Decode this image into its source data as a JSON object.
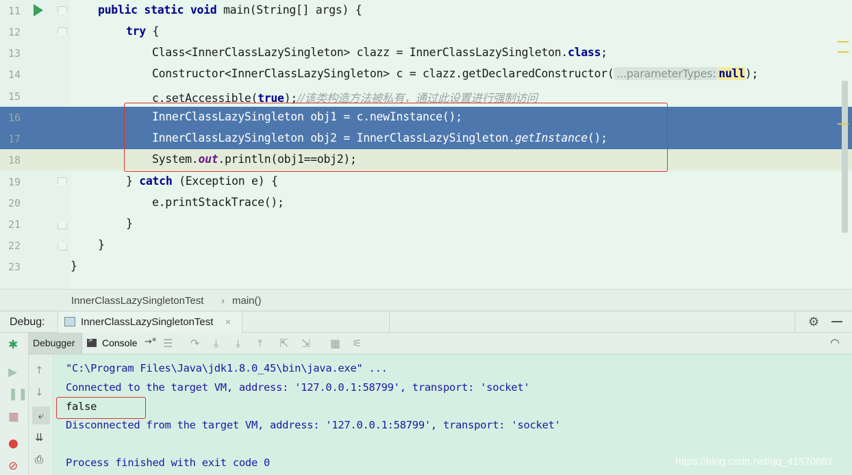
{
  "editor": {
    "lines": [
      {
        "num": "11",
        "segments": [
          {
            "t": "public static void ",
            "c": "kw"
          },
          {
            "t": "main(String[] args) {",
            "c": ""
          }
        ]
      },
      {
        "num": "12",
        "segments": [
          {
            "t": "try",
            "c": "kw"
          },
          {
            "t": " {",
            "c": ""
          }
        ]
      },
      {
        "num": "13",
        "segments": [
          {
            "t": "Class<InnerClassLazySingleton> clazz = InnerClassLazySingleton.",
            "c": ""
          },
          {
            "t": "class",
            "c": "kw"
          },
          {
            "t": ";",
            "c": ""
          }
        ]
      },
      {
        "num": "14",
        "segments": [
          {
            "t": "Constructor<InnerClassLazySingleton> c = clazz.getDeclaredConstructor(",
            "c": ""
          }
        ]
      },
      {
        "num": "15",
        "segments": [
          {
            "t": "c.setAccessible(",
            "c": ""
          },
          {
            "t": "true",
            "c": "kw"
          },
          {
            "t": ");",
            "c": ""
          }
        ]
      },
      {
        "num": "16",
        "segments": [
          {
            "t": "InnerClassLazySingleton obj1 = c.newInstance();",
            "c": ""
          }
        ]
      },
      {
        "num": "17",
        "segments": [
          {
            "t": "InnerClassLazySingleton obj2 = InnerClassLazySingleton.",
            "c": ""
          },
          {
            "t": "getInstance",
            "c": "it"
          },
          {
            "t": "();",
            "c": ""
          }
        ]
      },
      {
        "num": "18",
        "segments": [
          {
            "t": "System.",
            "c": ""
          },
          {
            "t": "out",
            "c": "st"
          },
          {
            "t": ".println(obj1==obj2);",
            "c": ""
          }
        ]
      },
      {
        "num": "19",
        "segments": [
          {
            "t": "} ",
            "c": ""
          },
          {
            "t": "catch",
            "c": "kw"
          },
          {
            "t": " (Exception e) {",
            "c": ""
          }
        ]
      },
      {
        "num": "20",
        "segments": [
          {
            "t": "e.printStackTrace();",
            "c": ""
          }
        ]
      },
      {
        "num": "21",
        "segments": [
          {
            "t": "}",
            "c": ""
          }
        ]
      },
      {
        "num": "22",
        "segments": [
          {
            "t": "}",
            "c": ""
          }
        ]
      },
      {
        "num": "23",
        "segments": [
          {
            "t": "}",
            "c": ""
          }
        ]
      }
    ],
    "param_hint": "...parameterTypes:",
    "null_kw": "null",
    "line14_end": ");",
    "comment": "//该类构造方法被私有，通过此设置进行强制访问"
  },
  "breadcrumb": {
    "class": "InnerClassLazySingletonTest",
    "sep": "›",
    "method": "main()"
  },
  "debug": {
    "label": "Debug:",
    "session": "InnerClassLazySingletonTest",
    "close": "×",
    "tabs": {
      "debugger": "Debugger",
      "console": "Console"
    },
    "console_arrow": "→*"
  },
  "console": {
    "lines": [
      {
        "text": "\"C:\\Program Files\\Java\\jdk1.8.0_45\\bin\\java.exe\" ...",
        "color": "blue"
      },
      {
        "text": "Connected to the target VM, address: '127.0.0.1:58799', transport: 'socket'",
        "color": "blue"
      },
      {
        "text": "false",
        "color": "black"
      },
      {
        "text": "Disconnected from the target VM, address: '127.0.0.1:58799', transport: 'socket'",
        "color": "blue"
      },
      {
        "text": "",
        "color": "blue"
      },
      {
        "text": "Process finished with exit code 0",
        "color": "blue"
      }
    ]
  },
  "watermark": "https://blog.csdn.net/qq_41570691",
  "icons": {
    "run": "run-gutter-icon",
    "gear": "gear-icon",
    "minimize": "minimize-icon",
    "bug": "bug-icon",
    "resume": "resume-icon",
    "pause": "pause-icon",
    "stop": "stop-icon",
    "breakpoints": "view-breakpoints-icon",
    "mute": "mute-breakpoints-icon"
  }
}
